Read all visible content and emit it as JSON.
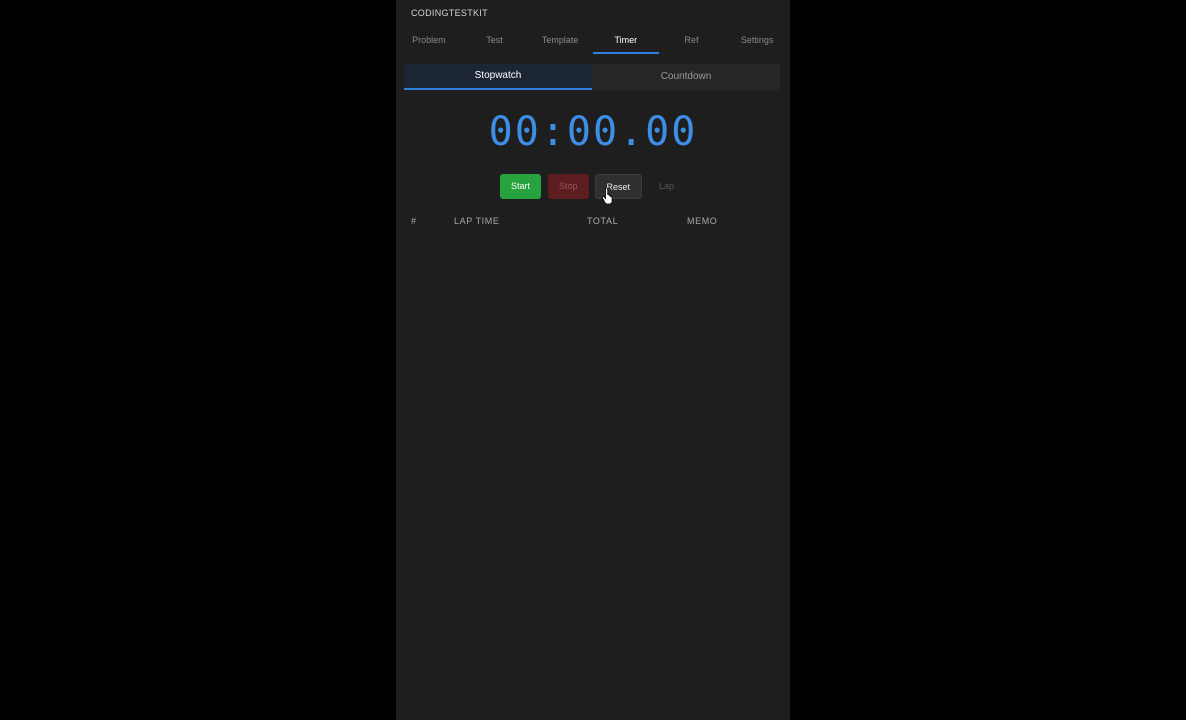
{
  "app": {
    "title": "CODINGTESTKIT"
  },
  "nav": {
    "tabs": [
      {
        "label": "Problem"
      },
      {
        "label": "Test"
      },
      {
        "label": "Template"
      },
      {
        "label": "Timer"
      },
      {
        "label": "Ref"
      },
      {
        "label": "Settings"
      }
    ],
    "active": "Timer"
  },
  "modes": {
    "stopwatch_label": "Stopwatch",
    "countdown_label": "Countdown",
    "active": "Stopwatch"
  },
  "timer": {
    "display": "00:00.00"
  },
  "controls": {
    "start_label": "Start",
    "stop_label": "Stop",
    "reset_label": "Reset",
    "lap_label": "Lap"
  },
  "laps": {
    "columns": [
      "#",
      "LAP TIME",
      "TOTAL",
      "MEMO"
    ],
    "rows": []
  },
  "colors": {
    "accent": "#2f7fe0",
    "timer": "#3d8ee6",
    "start": "#26a33e",
    "stop": "#5e1d21",
    "panel": "#1e1e1e",
    "background": "#000000"
  }
}
